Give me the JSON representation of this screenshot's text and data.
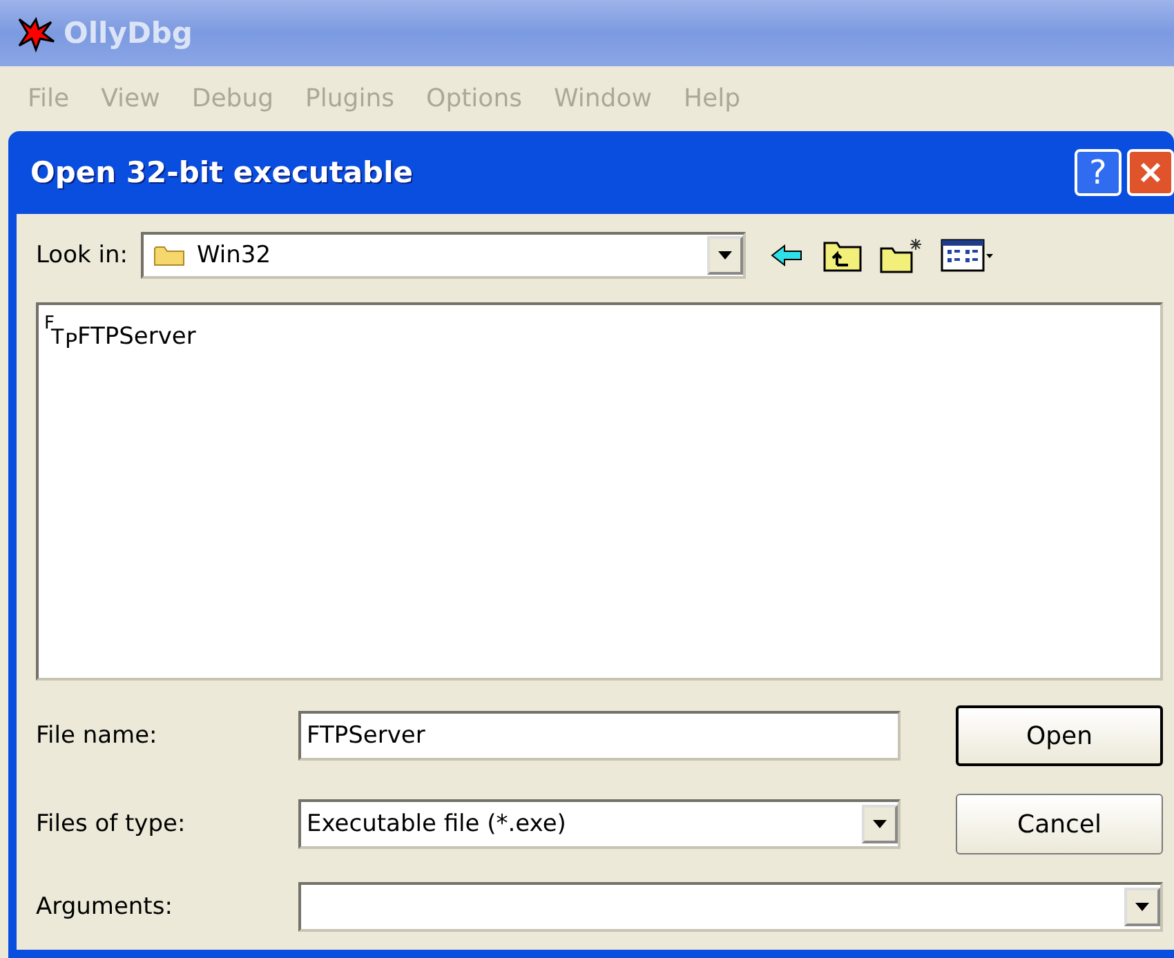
{
  "app": {
    "title": "OllyDbg",
    "menu": [
      "File",
      "View",
      "Debug",
      "Plugins",
      "Options",
      "Window",
      "Help"
    ]
  },
  "dialog": {
    "title": "Open 32-bit executable",
    "help_button": "?",
    "look_in": {
      "label": "Look in:",
      "value": "Win32"
    },
    "files": [
      {
        "icon_letters": [
          "F",
          "T",
          "P"
        ],
        "name": "FTPServer",
        "selected": false
      }
    ],
    "file_name": {
      "label": "File name:",
      "value": "FTPServer"
    },
    "files_of_type": {
      "label": "Files of type:",
      "value": "Executable file (*.exe)"
    },
    "arguments": {
      "label": "Arguments:"
    },
    "buttons": [
      "Open",
      "Cancel"
    ]
  }
}
